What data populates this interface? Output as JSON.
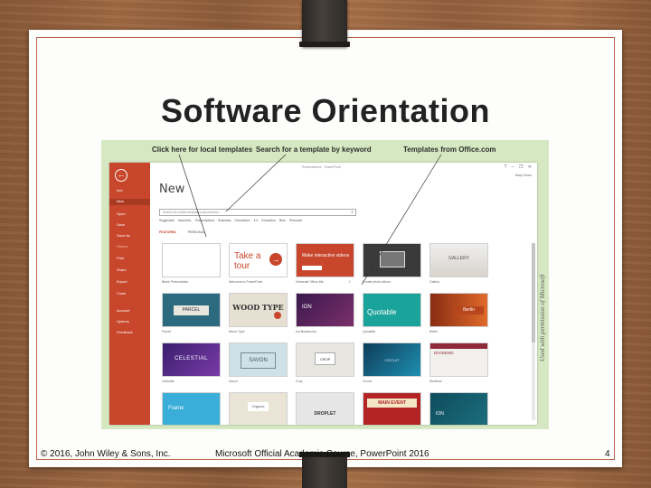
{
  "slide": {
    "title": "Software Orientation",
    "footer_left": "© 2016, John Wiley & Sons, Inc.",
    "footer_center": "Microsoft Official Academic Course, PowerPoint 2016",
    "page_number": "4",
    "side_credit": "Used with permission of Microsoft",
    "accent_color": "#b8664a"
  },
  "callouts": {
    "local_templates": "Click here for local templates",
    "search_keyword": "Search for a template by keyword",
    "office_templates": "Templates from Office.com"
  },
  "app": {
    "window_title": "Presentation1 - PowerPoint",
    "user_name": "Mary Jones",
    "back_icon": "back-arrow-icon",
    "side_color": "#c8462b",
    "sidebar": [
      {
        "label": "Info"
      },
      {
        "label": "New"
      },
      {
        "label": "Open"
      },
      {
        "label": "Save"
      },
      {
        "label": "Save As"
      },
      {
        "label": "History"
      },
      {
        "label": "Print"
      },
      {
        "label": "Share"
      },
      {
        "label": "Export"
      },
      {
        "label": "Close"
      },
      {
        "label": "Account"
      },
      {
        "label": "Options"
      },
      {
        "label": "Feedback"
      }
    ],
    "heading": "New",
    "search_placeholder": "Search for online templates and themes",
    "suggested": "Suggested searches: Presentations Business Orientation 4:3 Education Blue Personal",
    "tab_featured": "FEATURED",
    "tab_personal": "PERSONAL",
    "templates": [
      {
        "caption": "Blank Presentation",
        "text": ""
      },
      {
        "caption": "Welcome to PowerPoint",
        "text": "Take a tour"
      },
      {
        "caption": "Generate Office Mix",
        "text": "Make interactive videos"
      },
      {
        "caption": "Create photo album",
        "text": ""
      },
      {
        "caption": "Gallery",
        "text": "GALLERY"
      },
      {
        "caption": "Parcel",
        "text": "PARCEL"
      },
      {
        "caption": "Wood Type",
        "text": "WOOD TYPE"
      },
      {
        "caption": "Ion Boardroom",
        "text": "ION"
      },
      {
        "caption": "Quotable",
        "text": "Quotable"
      },
      {
        "caption": "Berlin",
        "text": "Berlin"
      },
      {
        "caption": "Celestial",
        "text": "CELESTIAL"
      },
      {
        "caption": "Savon",
        "text": "SAVON"
      },
      {
        "caption": "Crop",
        "text": "CROP"
      },
      {
        "caption": "Circuit",
        "text": "CIRCUIT"
      },
      {
        "caption": "Dividend",
        "text": "DIVIDEND"
      },
      {
        "caption": "",
        "text": "Frame"
      },
      {
        "caption": "",
        "text": "Organic"
      },
      {
        "caption": "",
        "text": "DROPLET"
      },
      {
        "caption": "",
        "text": "MAIN EVENT"
      },
      {
        "caption": "",
        "text": "ION"
      }
    ]
  }
}
